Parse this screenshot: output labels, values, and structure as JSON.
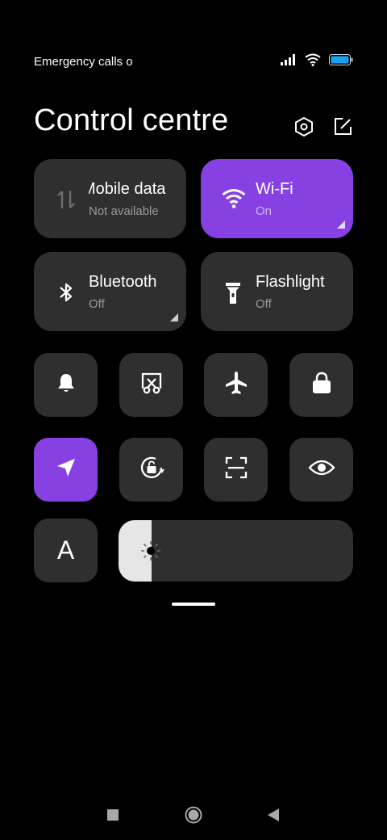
{
  "status_bar": {
    "text": "Emergency calls o",
    "battery_color": "#1aa0f0"
  },
  "header": {
    "title": "Control centre",
    "settings_icon": "settings-hex-icon",
    "edit_icon": "edit-icon"
  },
  "tiles": {
    "mobile_data": {
      "label": "Mobile data",
      "status": "Not available",
      "active": false
    },
    "wifi": {
      "label": "Wi-Fi",
      "status": "On",
      "active": true
    },
    "bluetooth": {
      "label": "Bluetooth",
      "status": "Off",
      "active": false
    },
    "flashlight": {
      "label": "Flashlight",
      "status": "Off",
      "active": false
    }
  },
  "toggles": [
    {
      "name": "bell-icon",
      "active": false
    },
    {
      "name": "screenshot-scissors-icon",
      "active": false
    },
    {
      "name": "airplane-icon",
      "active": false
    },
    {
      "name": "lock-icon",
      "active": false
    },
    {
      "name": "location-icon",
      "active": true
    },
    {
      "name": "rotation-lock-icon",
      "active": false
    },
    {
      "name": "scan-icon",
      "active": false
    },
    {
      "name": "eye-icon",
      "active": false
    }
  ],
  "font_tile": {
    "letter": "A"
  },
  "brightness": {
    "level": 0.14
  },
  "colors": {
    "accent": "#8741e3",
    "tile": "#2f2f2f",
    "background": "#000000"
  }
}
